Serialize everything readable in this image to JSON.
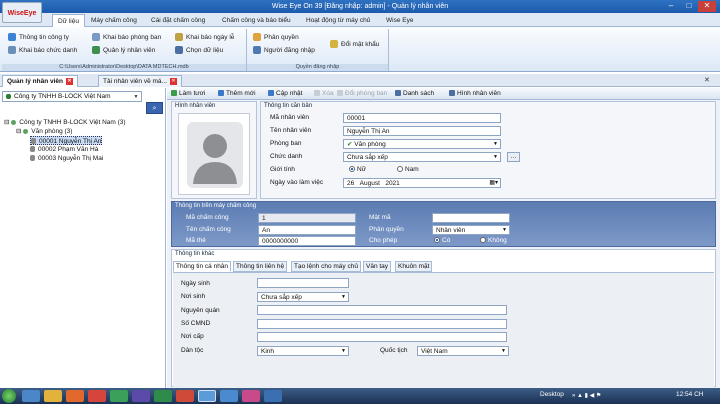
{
  "window": {
    "title": "Wise Eye On 39 [Đăng nhập: admin] - Quản lý nhân viên",
    "logo": "WiseEye"
  },
  "menu": [
    {
      "label": "Dữ liệu"
    },
    {
      "label": "Máy chấm công"
    },
    {
      "label": "Cài đặt chấm công"
    },
    {
      "label": "Chấm công và báo biểu"
    },
    {
      "label": "Hoạt động từ máy chủ"
    },
    {
      "label": "Wise Eye"
    }
  ],
  "ribbon": {
    "col1": [
      "Thông tin công ty",
      "Khai báo chức danh"
    ],
    "col2": [
      "Khai báo phòng ban",
      "Quản lý nhân viên"
    ],
    "col3": [
      "Khai báo ngày lễ",
      "Chọn dữ liệu"
    ],
    "col4": [
      "Phân quyền",
      "Người đăng nhập"
    ],
    "col5": [
      "Đổi mật khẩu"
    ],
    "group1_caption": "C:\\Users\\Administrator\\Desktop\\DATA MDTECH.mdb",
    "group2_caption": "Quyền đăng nhập"
  },
  "doc_tabs": [
    {
      "label": "Quản lý nhân viên"
    },
    {
      "label": "Tải nhân viên về má..."
    }
  ],
  "left": {
    "company_select": "Công ty TNHH B-LOCK Việt Nam",
    "tree": {
      "root": "Công ty TNHH B-LOCK Việt Nam (3)",
      "dept": "Văn phòng (3)",
      "employees": [
        "00001 Nguyễn Thị An",
        "00002 Phạm Văn Hà",
        "00003 Nguyễn Thị Mai"
      ]
    }
  },
  "toolbar": [
    "Làm tươi",
    "Thêm mới",
    "Cập nhật",
    "Xóa",
    "Đổi phòng ban",
    "Danh sách",
    "Hình nhân viên"
  ],
  "photo": {
    "title": "Hình nhân viên"
  },
  "basic": {
    "title": "Thông tin căn bản",
    "labels": [
      "Mã nhân viên",
      "Tên nhân viên",
      "Phòng ban",
      "Chức danh",
      "Giới tính",
      "Ngày vào làm việc"
    ],
    "code": "00001",
    "name": "Nguyễn Thị An",
    "dept": "Văn phòng",
    "title_value": "Chưa sắp xếp",
    "gender_female": "Nữ",
    "gender_male": "Nam",
    "date_day": "26",
    "date_month": "August",
    "date_year": "2021"
  },
  "machine": {
    "title": "Thông tin trên máy chấm công",
    "labels": [
      "Mã chấm công",
      "Tên chấm công",
      "Mã thẻ",
      "Mật mã",
      "Phân quyền",
      "Cho phép"
    ],
    "att_code": "1",
    "att_name": "An",
    "card": "0000000000",
    "password": "",
    "privilege": "Nhân viên",
    "allow_yes": "Có",
    "allow_no": "Không"
  },
  "other": {
    "title": "Thông tin khác",
    "tabs": [
      "Thông tin cá nhân",
      "Thông tin liên hệ",
      "Tạo lệnh cho máy chủ",
      "Vân tay",
      "Khuôn mặt"
    ],
    "labels": [
      "Ngày sinh",
      "Nơi sinh",
      "Nguyên quán",
      "Số CMND",
      "Nơi cấp",
      "Dân tộc",
      "Quốc tịch"
    ],
    "birthplace": "Chưa sắp xếp",
    "ethnicity": "Kinh",
    "nationality": "Việt Nam"
  },
  "taskbar": {
    "desktop": "Desktop",
    "time": "12:54 CH"
  }
}
